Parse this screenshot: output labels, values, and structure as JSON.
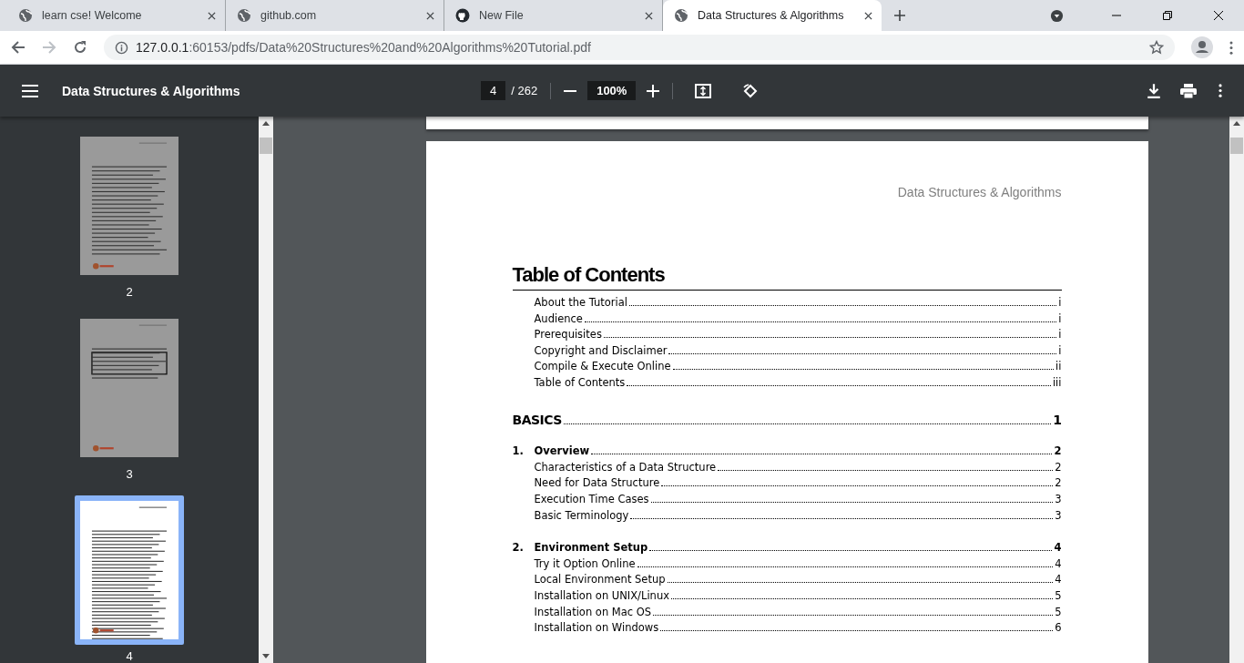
{
  "tabs": [
    {
      "title": "learn cse! Welcome",
      "kind": "site",
      "selected": false
    },
    {
      "title": "github.com",
      "kind": "site",
      "selected": false
    },
    {
      "title": "New File",
      "kind": "repo",
      "selected": false
    },
    {
      "title": "Data Structures & Algorithms",
      "kind": "site",
      "selected": true
    }
  ],
  "address_bar": {
    "host": "127.0.0.1",
    "path": ":60153/pdfs/Data%20Structures%20and%20Algorithms%20Tutorial.pdf"
  },
  "viewer": {
    "title": "Data Structures & Algorithms",
    "page": "4",
    "page_count": "/ 262",
    "zoom": "100%"
  },
  "thumbnails": [
    {
      "label": "2",
      "selected": false,
      "kind": "text"
    },
    {
      "label": "3",
      "selected": false,
      "kind": "code"
    },
    {
      "label": "4",
      "selected": true,
      "kind": "toc"
    }
  ],
  "page": {
    "header": "Data Structures & Algorithms",
    "heading": "Table of Contents",
    "entries": [
      {
        "kind": "entry",
        "text": "About the Tutorial",
        "page": "i"
      },
      {
        "kind": "entry",
        "text": "Audience",
        "page": "i"
      },
      {
        "kind": "entry",
        "text": "Prerequisites",
        "page": "i"
      },
      {
        "kind": "entry",
        "text": "Copyright and Disclaimer",
        "page": "i"
      },
      {
        "kind": "entry",
        "text": "Compile & Execute Online",
        "page": "ii"
      },
      {
        "kind": "entry",
        "text": "Table of Contents",
        "page": "iii"
      },
      {
        "kind": "part",
        "text": "BASICS",
        "page": "1"
      },
      {
        "kind": "chapter",
        "number": "1.",
        "text": "Overview",
        "page": "2"
      },
      {
        "kind": "entry",
        "text": "Characteristics of a Data Structure",
        "page": "2"
      },
      {
        "kind": "entry",
        "text": "Need for Data Structure",
        "page": "2"
      },
      {
        "kind": "entry",
        "text": "Execution Time Cases",
        "page": "3"
      },
      {
        "kind": "entry",
        "text": "Basic Terminology",
        "page": "3"
      },
      {
        "kind": "chapter",
        "number": "2.",
        "text": "Environment Setup",
        "page": "4"
      },
      {
        "kind": "entry",
        "text": "Try it Option Online",
        "page": "4"
      },
      {
        "kind": "entry",
        "text": "Local Environment Setup",
        "page": "4"
      },
      {
        "kind": "entry",
        "text": "Installation on UNIX/Linux",
        "page": "5"
      },
      {
        "kind": "entry",
        "text": "Installation on Mac OS",
        "page": "5"
      },
      {
        "kind": "entry",
        "text": "Installation on Windows",
        "page": "6"
      }
    ]
  }
}
